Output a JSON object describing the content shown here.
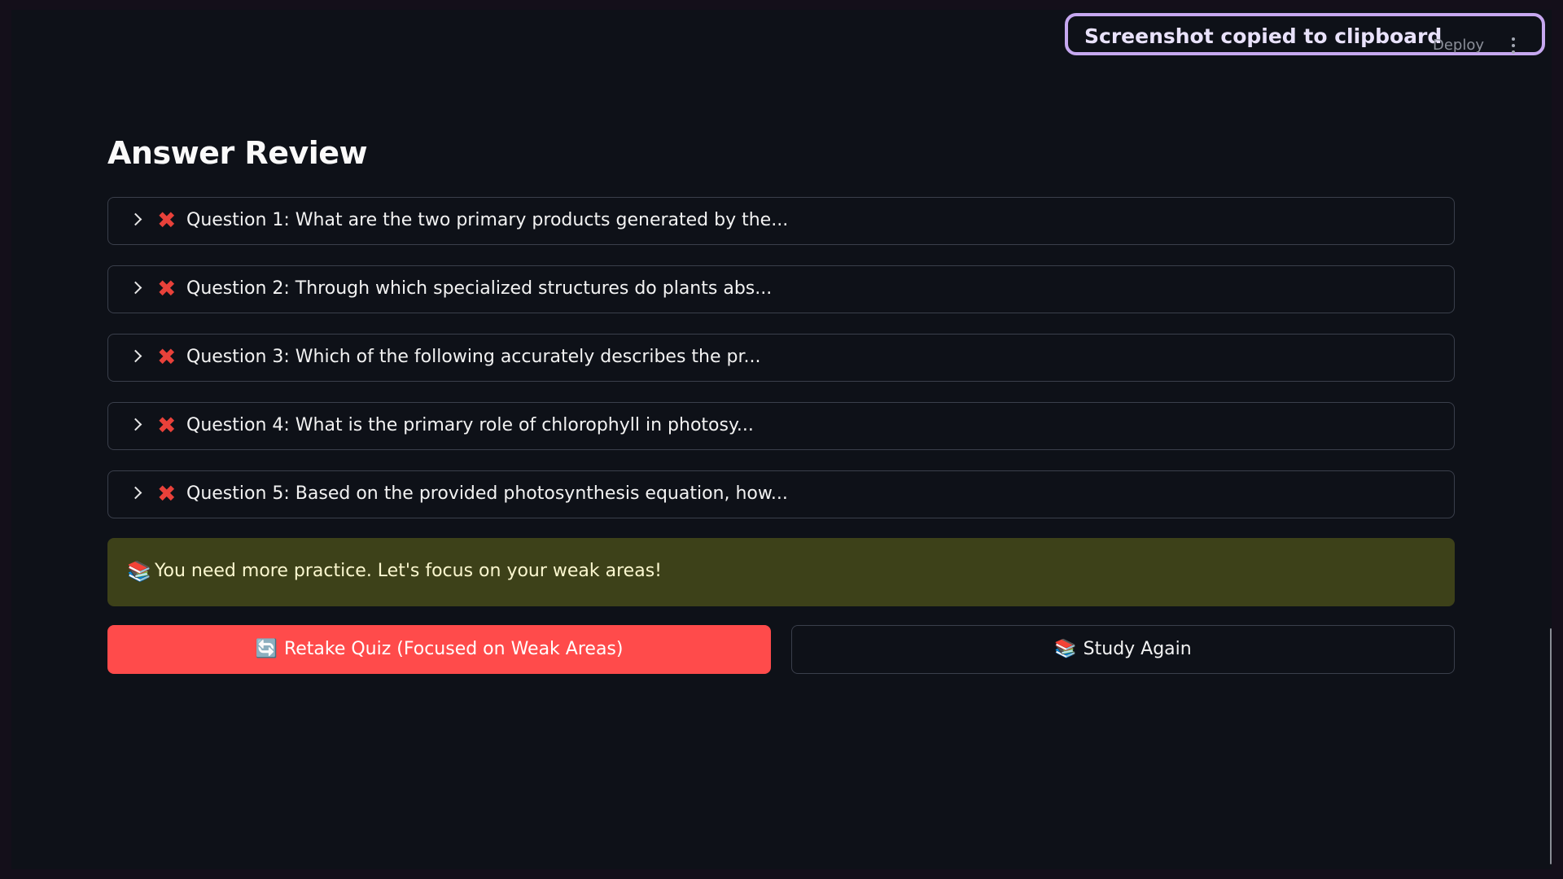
{
  "toast": {
    "message": "Screenshot copied to clipboard"
  },
  "header": {
    "deploy_label": "Deploy",
    "menu_icon": "more-vertical-icon"
  },
  "main": {
    "title": "Answer Review",
    "status_icon": "cross-mark-icon",
    "questions": [
      {
        "label": "Question 1: What are the two primary products generated by the..."
      },
      {
        "label": "Question 2: Through which specialized structures do plants abs..."
      },
      {
        "label": "Question 3: Which of the following accurately describes the pr..."
      },
      {
        "label": "Question 4: What is the primary role of chlorophyll in photosy..."
      },
      {
        "label": "Question 5: Based on the provided photosynthesis equation, how..."
      }
    ],
    "feedback": {
      "icon": "books-icon",
      "message": "You need more practice. Let's focus on your weak areas!",
      "background": "#3d4119"
    },
    "actions": {
      "retake_icon": "refresh-icon",
      "retake_label": "Retake Quiz (Focused on Weak Areas)",
      "study_icon": "books-icon",
      "study_label": "Study Again",
      "primary_color": "#ff4b4b"
    }
  }
}
